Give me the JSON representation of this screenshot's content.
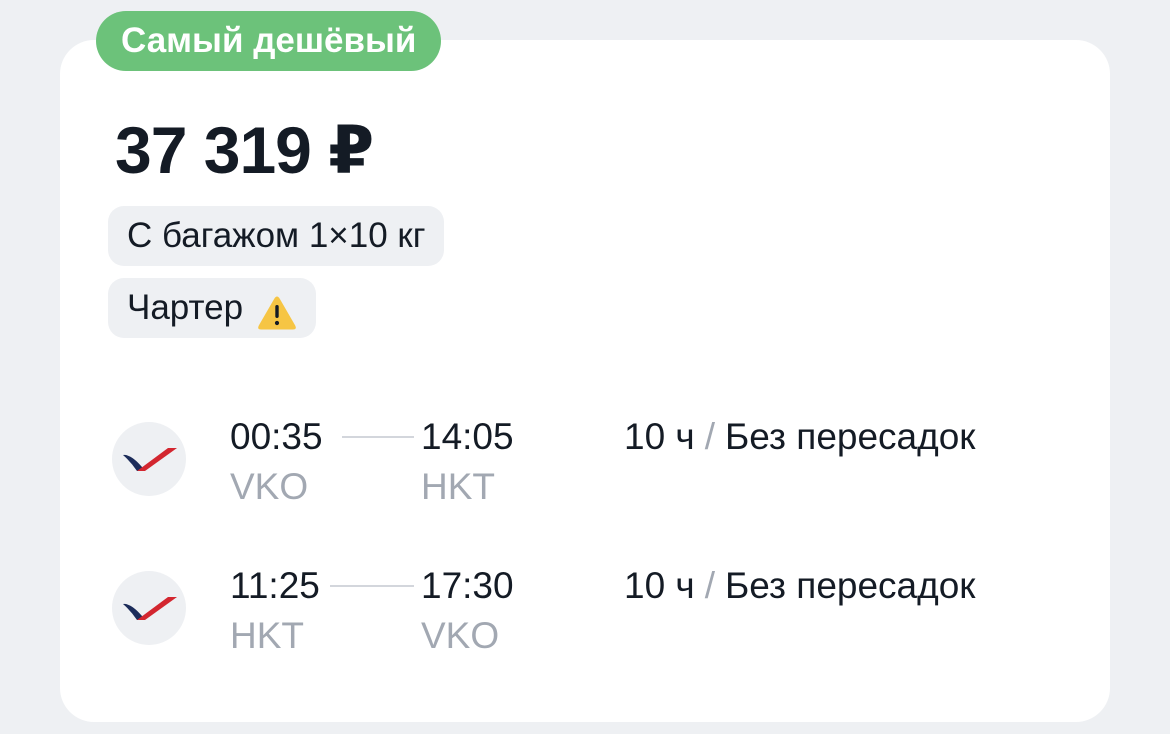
{
  "badge": {
    "label": "Самый дешёвый",
    "color": "#6cc27a"
  },
  "price": "37 319 ₽",
  "chips": {
    "baggage": "С багажом 1×10 кг",
    "charter": "Чартер",
    "charter_icon": "warning-icon"
  },
  "segments": [
    {
      "airline_icon": "airline-logo",
      "dep_time": "00:35",
      "dep_code": "VKO",
      "arr_time": "14:05",
      "arr_code": "HKT",
      "duration": "10 ч",
      "separator": "/",
      "stops": "Без пересадок"
    },
    {
      "airline_icon": "airline-logo",
      "dep_time": "11:25",
      "dep_code": "HKT",
      "arr_time": "17:30",
      "arr_code": "VKO",
      "duration": "10 ч",
      "separator": "/",
      "stops": "Без пересадок"
    }
  ]
}
